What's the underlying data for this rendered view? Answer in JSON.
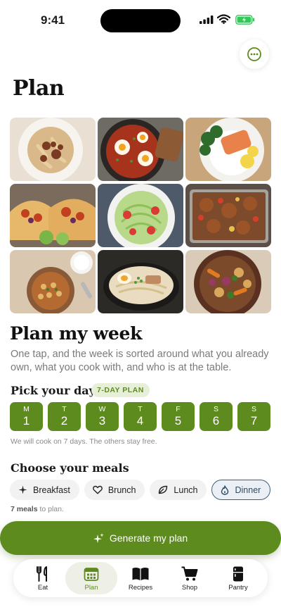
{
  "status": {
    "time": "9:41"
  },
  "page": {
    "title": "Plan"
  },
  "grid": {
    "tiles": [
      "pasta-bolognese-photo",
      "shakshuka-photo",
      "salmon-rice-photo",
      "tacos-photo",
      "zucchini-noodle-salad-photo",
      "sheet-pan-chicken-photo",
      "chickpea-curry-photo",
      "ramen-photo",
      "roasted-vegetables-photo"
    ]
  },
  "plan_week": {
    "title": "Plan my week",
    "subtitle": "One tap, and the week is sorted around what you already own, what you cook with, and who is at the table."
  },
  "days": {
    "title": "Pick your days",
    "badge": "7-DAY PLAN",
    "items": [
      {
        "letter": "M",
        "num": "1"
      },
      {
        "letter": "T",
        "num": "2"
      },
      {
        "letter": "W",
        "num": "3"
      },
      {
        "letter": "T",
        "num": "4"
      },
      {
        "letter": "F",
        "num": "5"
      },
      {
        "letter": "S",
        "num": "6"
      },
      {
        "letter": "S",
        "num": "7"
      }
    ],
    "note": "We will cook on 7 days. The others stay free."
  },
  "meals": {
    "title": "Choose your meals",
    "options": [
      {
        "label": "Breakfast",
        "icon": "sparkle-icon",
        "selected": false
      },
      {
        "label": "Brunch",
        "icon": "heart-icon",
        "selected": false
      },
      {
        "label": "Lunch",
        "icon": "leaf-icon",
        "selected": false
      },
      {
        "label": "Dinner",
        "icon": "flame-icon",
        "selected": true
      }
    ],
    "count": "7 meals",
    "note_suffix": " to plan."
  },
  "generate": {
    "label": "Generate my plan"
  },
  "tabs": [
    {
      "label": "Eat",
      "icon": "fork-knife-icon",
      "active": false
    },
    {
      "label": "Plan",
      "icon": "calendar-icon",
      "active": true
    },
    {
      "label": "Recipes",
      "icon": "book-icon",
      "active": false
    },
    {
      "label": "Shop",
      "icon": "cart-icon",
      "active": false
    },
    {
      "label": "Pantry",
      "icon": "fridge-icon",
      "active": false
    }
  ],
  "colors": {
    "accent": "#5e8b1e",
    "badge_bg": "#e7efd9",
    "selected_chip": "#43607a"
  }
}
